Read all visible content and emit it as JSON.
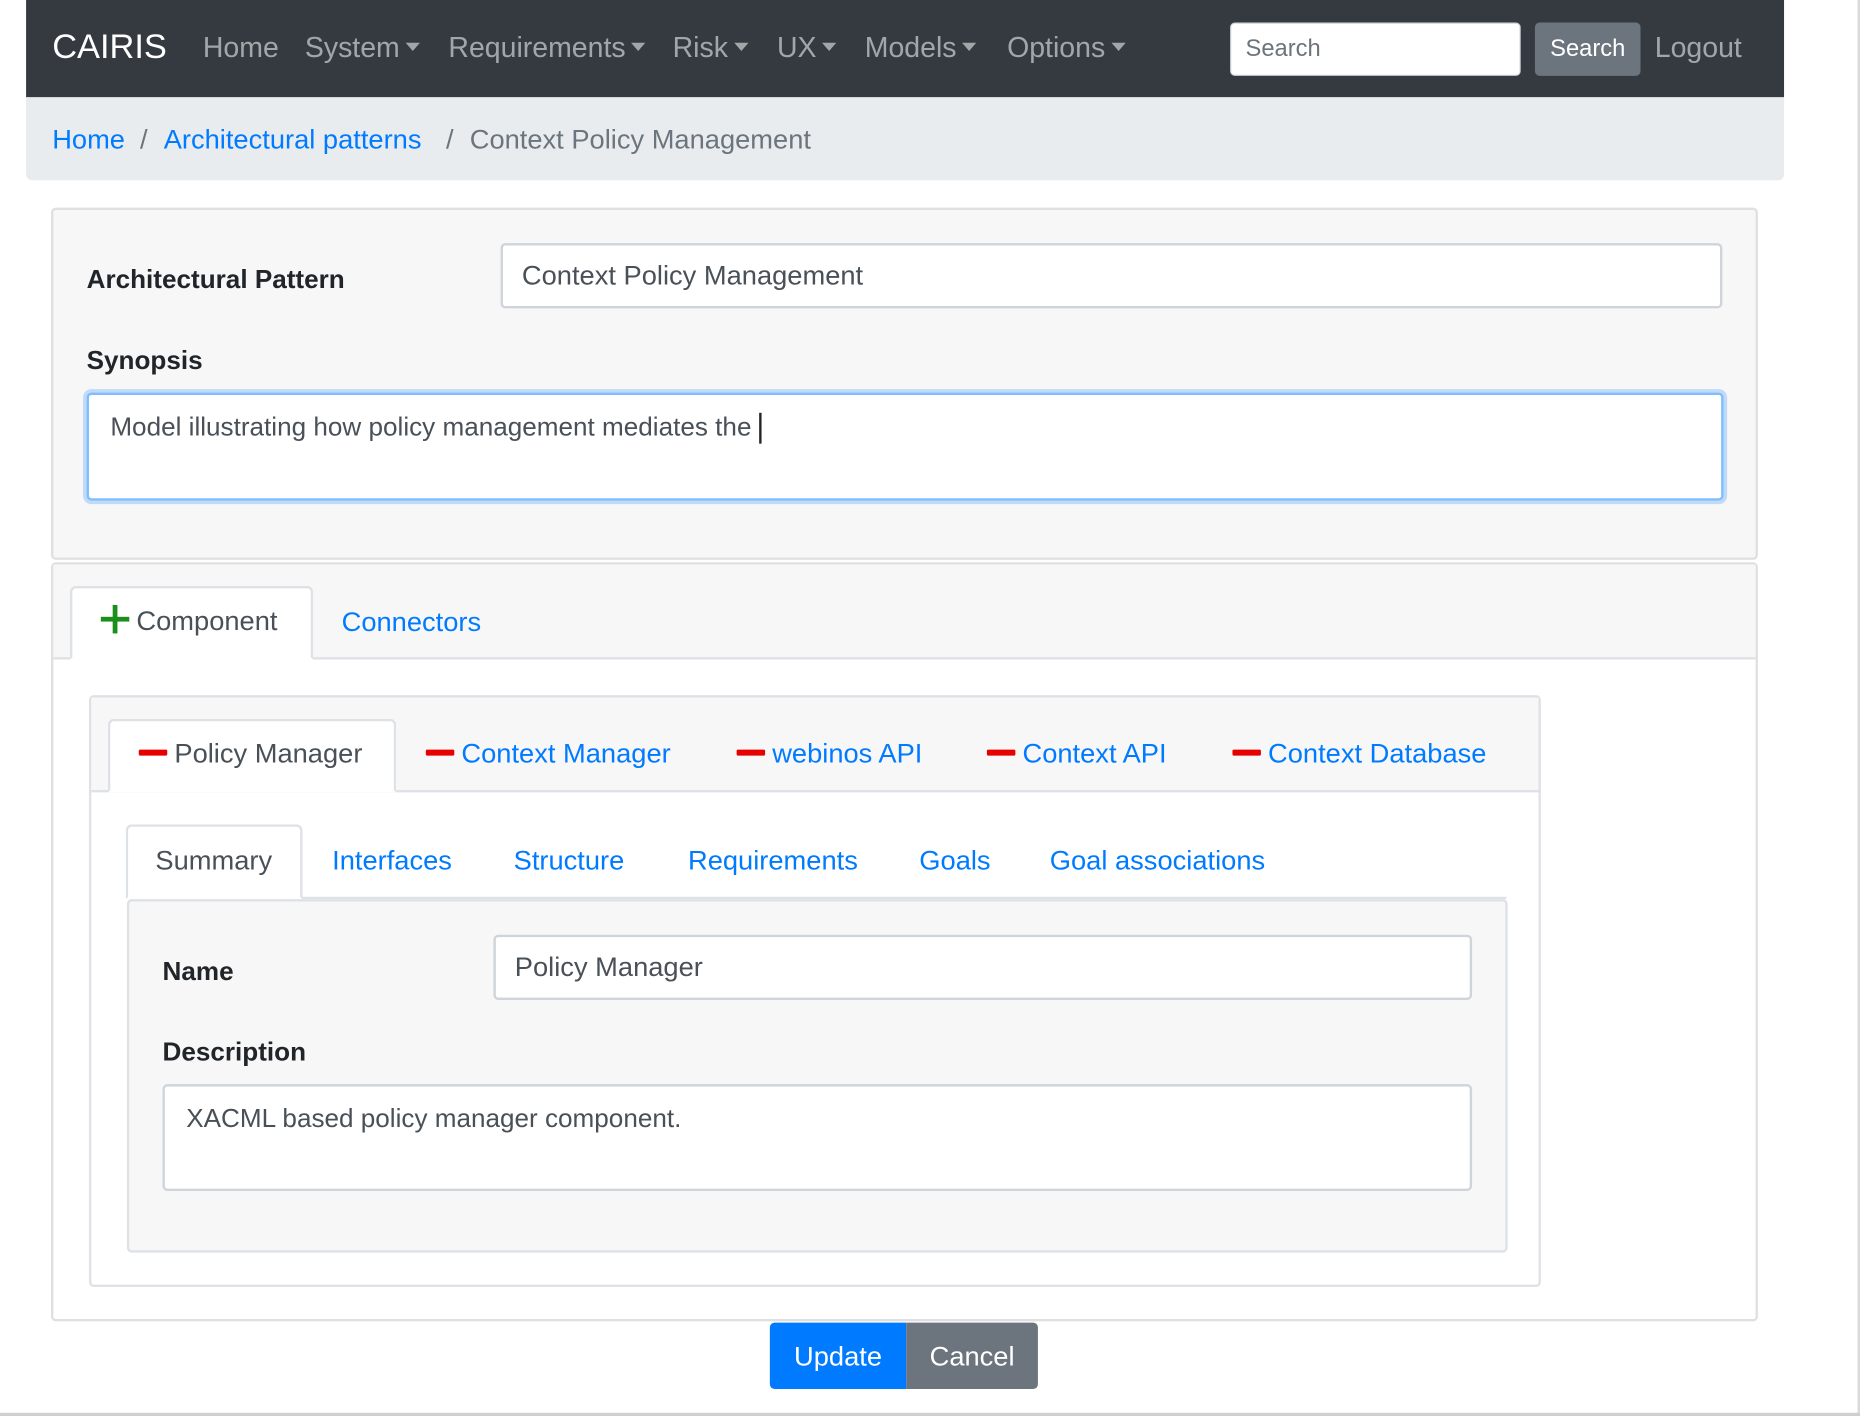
{
  "navbar": {
    "brand": "CAIRIS",
    "items": [
      {
        "label": "Home",
        "dropdown": false
      },
      {
        "label": "System",
        "dropdown": true
      },
      {
        "label": "Requirements",
        "dropdown": true
      },
      {
        "label": "Risk",
        "dropdown": true
      },
      {
        "label": "UX",
        "dropdown": true
      },
      {
        "label": "Models",
        "dropdown": true
      },
      {
        "label": "Options",
        "dropdown": true
      }
    ],
    "search_placeholder": "Search",
    "search_button": "Search",
    "logout": "Logout"
  },
  "breadcrumb": {
    "items": [
      "Home",
      "Architectural patterns",
      "Context Policy Management"
    ],
    "separator": "/"
  },
  "form": {
    "pattern_label": "Architectural Pattern",
    "pattern_value": "Context Policy Management",
    "synopsis_label": "Synopsis",
    "synopsis_value": "Model illustrating how policy management mediates the"
  },
  "outer_tabs": {
    "component": "Component",
    "connectors": "Connectors"
  },
  "component_tabs": [
    "Policy Manager",
    "Context Manager",
    "webinos API",
    "Context API",
    "Context Database"
  ],
  "inner_tabs": [
    "Summary",
    "Interfaces",
    "Structure",
    "Requirements",
    "Goals",
    "Goal associations"
  ],
  "summary": {
    "name_label": "Name",
    "name_value": "Policy Manager",
    "description_label": "Description",
    "description_value": "XACML based policy manager component."
  },
  "buttons": {
    "update": "Update",
    "cancel": "Cancel"
  },
  "colors": {
    "navbar_bg": "#343a40",
    "link": "#007bff",
    "add_icon": "#1a8f1a",
    "remove_icon": "#e60000",
    "primary_button": "#007bff",
    "secondary_button": "#6c757d"
  },
  "icons": {
    "add": "plus-icon",
    "remove": "minus-icon",
    "dropdown": "caret-down-icon"
  }
}
